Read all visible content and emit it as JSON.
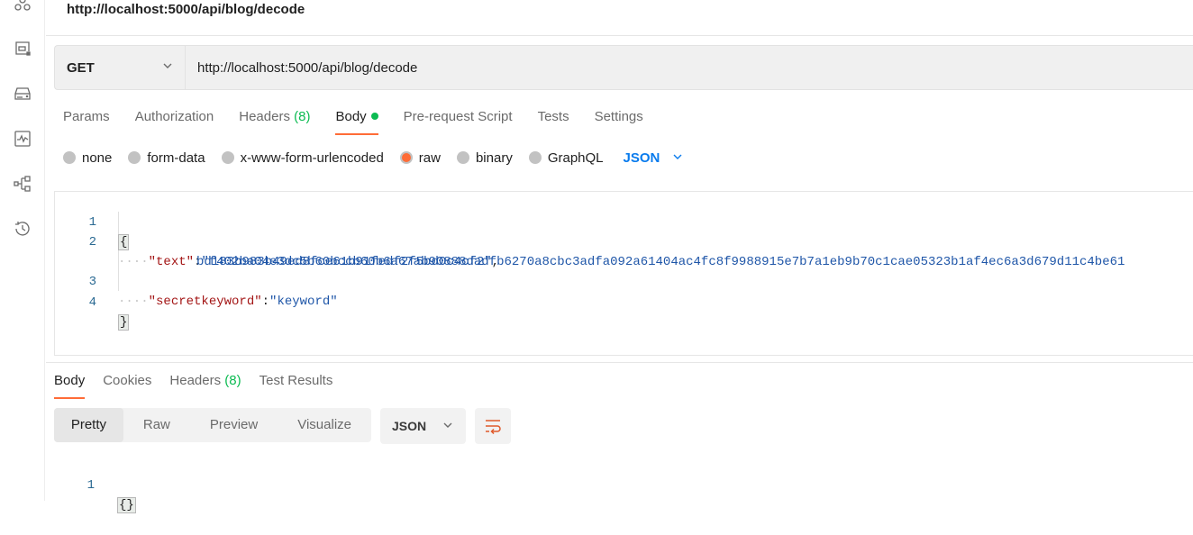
{
  "sidebar": {
    "icons": [
      {
        "name": "apis-icon"
      },
      {
        "name": "environments-icon"
      },
      {
        "name": "mock-servers-icon"
      },
      {
        "name": "monitors-icon"
      },
      {
        "name": "flows-icon"
      },
      {
        "name": "history-icon"
      }
    ]
  },
  "header": {
    "title": "http://localhost:5000/api/blog/decode"
  },
  "request": {
    "method": "GET",
    "url": "http://localhost:5000/api/blog/decode",
    "tabs": [
      {
        "label": "Params"
      },
      {
        "label": "Authorization"
      },
      {
        "label": "Headers",
        "count": "(8)"
      },
      {
        "label": "Body",
        "active": true,
        "indicator": "green-dot"
      },
      {
        "label": "Pre-request Script"
      },
      {
        "label": "Tests"
      },
      {
        "label": "Settings"
      }
    ],
    "body_types": [
      {
        "label": "none",
        "selected": false
      },
      {
        "label": "form-data",
        "selected": false
      },
      {
        "label": "x-www-form-urlencoded",
        "selected": false
      },
      {
        "label": "raw",
        "selected": true
      },
      {
        "label": "binary",
        "selected": false
      },
      {
        "label": "GraphQL",
        "selected": false
      }
    ],
    "body_language": "JSON",
    "body_editor": {
      "line_numbers": [
        "1",
        "2",
        "3",
        "4"
      ],
      "open_brace": "{",
      "close_brace": "}",
      "indent": "····",
      "text_key": "\"text\"",
      "text_value_line1": "\"f402ba04e3dc5b60bccb60b6a67ab90888dadfb6270a8cbc3adfa092a61404ac4fc8f9988915e7b7a1eb9b70c1cae05323b1af4ec6a3d679d11c4be61",
      "text_value_line2": "bd183b983b49ed8fce61b91fedf2f5bd0c4cf2\"",
      "secret_key": "\"secretkeyword\"",
      "secret_value": "\"keyword\"",
      "colon": ":",
      "comma": ","
    }
  },
  "response": {
    "tabs": [
      {
        "label": "Body",
        "active": true
      },
      {
        "label": "Cookies"
      },
      {
        "label": "Headers",
        "count": "(8)"
      },
      {
        "label": "Test Results"
      }
    ],
    "view_modes": [
      "Pretty",
      "Raw",
      "Preview",
      "Visualize"
    ],
    "active_view": "Pretty",
    "language": "JSON",
    "body": {
      "line_number": "1",
      "content": "{}"
    }
  },
  "colors": {
    "accent": "#ff6c37",
    "success": "#0cbb52",
    "link": "#097bed",
    "json_key": "#a31515",
    "json_string": "#1f56a8"
  }
}
